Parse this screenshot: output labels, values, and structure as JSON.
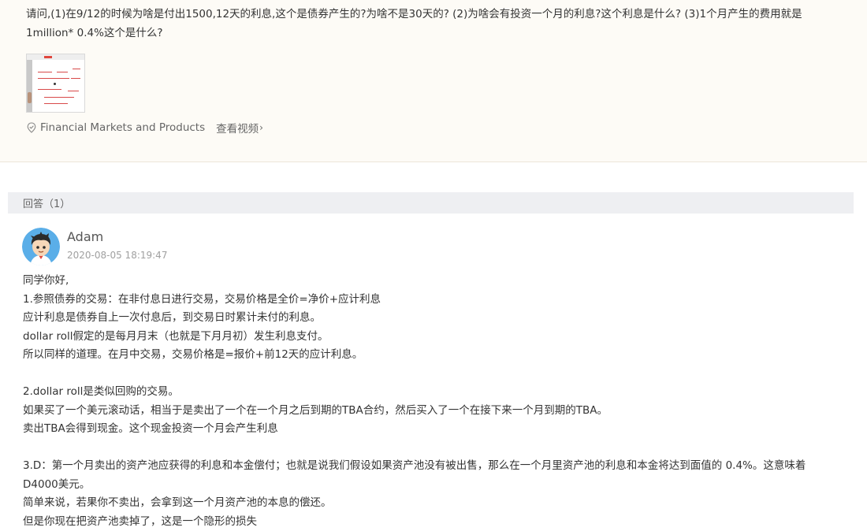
{
  "question": {
    "text": "请问,(1)在9/12的时候为啥是付出1500,12天的利息,这个是债券产生的?为啥不是30天的? (2)为啥会有投资一个月的利息?这个利息是什么? (3)1个月产生的费用就是1million* 0.4%这个是什么?",
    "course_name": "Financial Markets and Products",
    "view_video_label": "查看视频",
    "view_video_chevron": "›",
    "course_icon": "location-pin-icon"
  },
  "answers_header": {
    "label": "回答（1）"
  },
  "answer": {
    "author": "Adam",
    "timestamp": "2020-08-05 18:19:47",
    "lines": [
      "同学你好,",
      "1.参照债券的交易：在非付息日进行交易，交易价格是全价=净价+应计利息",
      "应计利息是债券自上一次付息后，到交易日时累计未付的利息。",
      "dollar roll假定的是每月月末（也就是下月月初）发生利息支付。",
      "所以同样的道理。在月中交易，交易价格是=报价+前12天的应计利息。",
      "",
      "2.dollar roll是类似回购的交易。",
      "如果买了一个美元滚动话，相当于是卖出了一个在一个月之后到期的TBA合约，然后买入了一个在接下来一个月到期的TBA。",
      "卖出TBA会得到现金。这个现金投资一个月会产生利息",
      "",
      "3.D：第一个月卖出的资产池应获得的利息和本金偿付；也就是说我们假设如果资产池没有被出售，那么在一个月里资产池的利息和本金将达到面值的 0.4%。这意味着 D4000美元。",
      "简单来说，若果你不卖出，会拿到这一个月资产池的本息的偿还。",
      "但是你现在把资产池卖掉了，这是一个隐形的损失"
    ]
  },
  "colors": {
    "question_bg": "#fdfbf6",
    "answers_bar_bg": "#eeeff2",
    "avatar_bg": "#5aaee8",
    "timestamp": "#a0a0a0"
  }
}
